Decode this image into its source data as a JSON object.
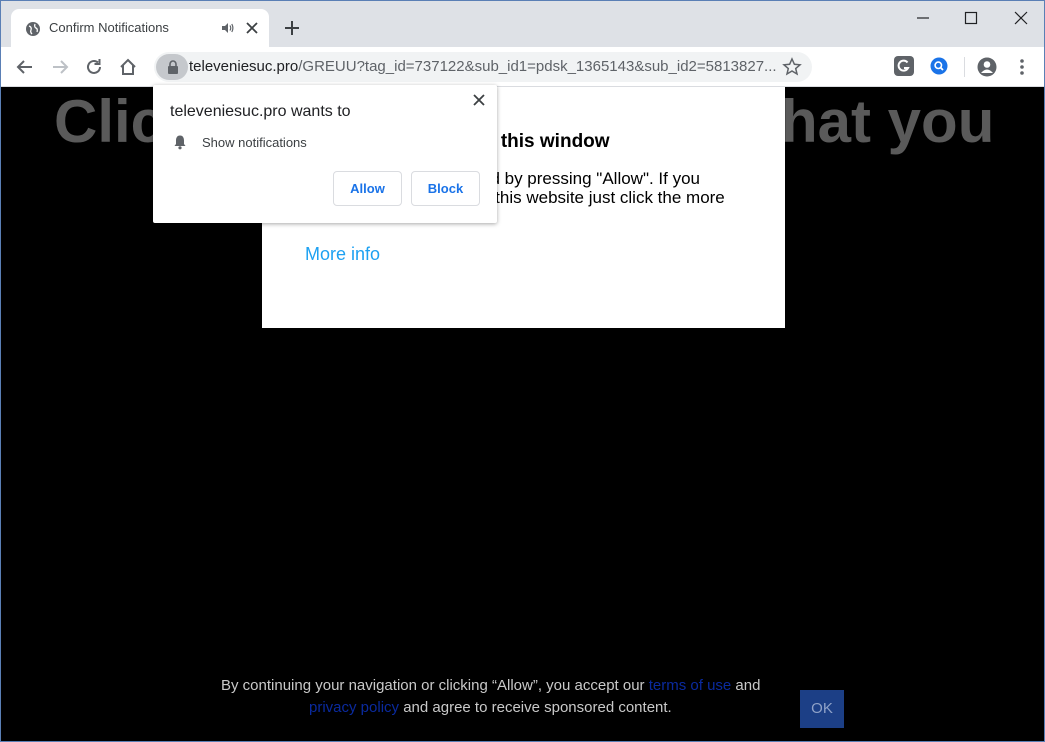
{
  "tab": {
    "title": "Confirm Notifications"
  },
  "address_bar": {
    "host": "televeniesuc.pro",
    "path": "/GREUU?tag_id=737122&sub_id1=pdsk_1365143&sub_id2=5813827..."
  },
  "page": {
    "background_heading": "Click                                                  hat you",
    "modal": {
      "title": "e this window",
      "body": "ed by pressing \"Allow\". If you\ng this website just click the more\ninformation",
      "more_info": "More info"
    },
    "footer": {
      "text1": "By continuing your navigation or clicking “Allow”, you accept our ",
      "terms_link": "terms of use",
      "text2": " and",
      "privacy_link": "privacy policy",
      "text3": " and agree to receive sponsored content.",
      "ok_label": "OK"
    }
  },
  "permission_popup": {
    "title": "televeniesuc.pro wants to",
    "permission": "Show notifications",
    "allow_label": "Allow",
    "block_label": "Block"
  },
  "colors": {
    "link_blue": "#1a73e8",
    "more_info": "#1da1f2",
    "ok_button": "#1c3f86"
  }
}
